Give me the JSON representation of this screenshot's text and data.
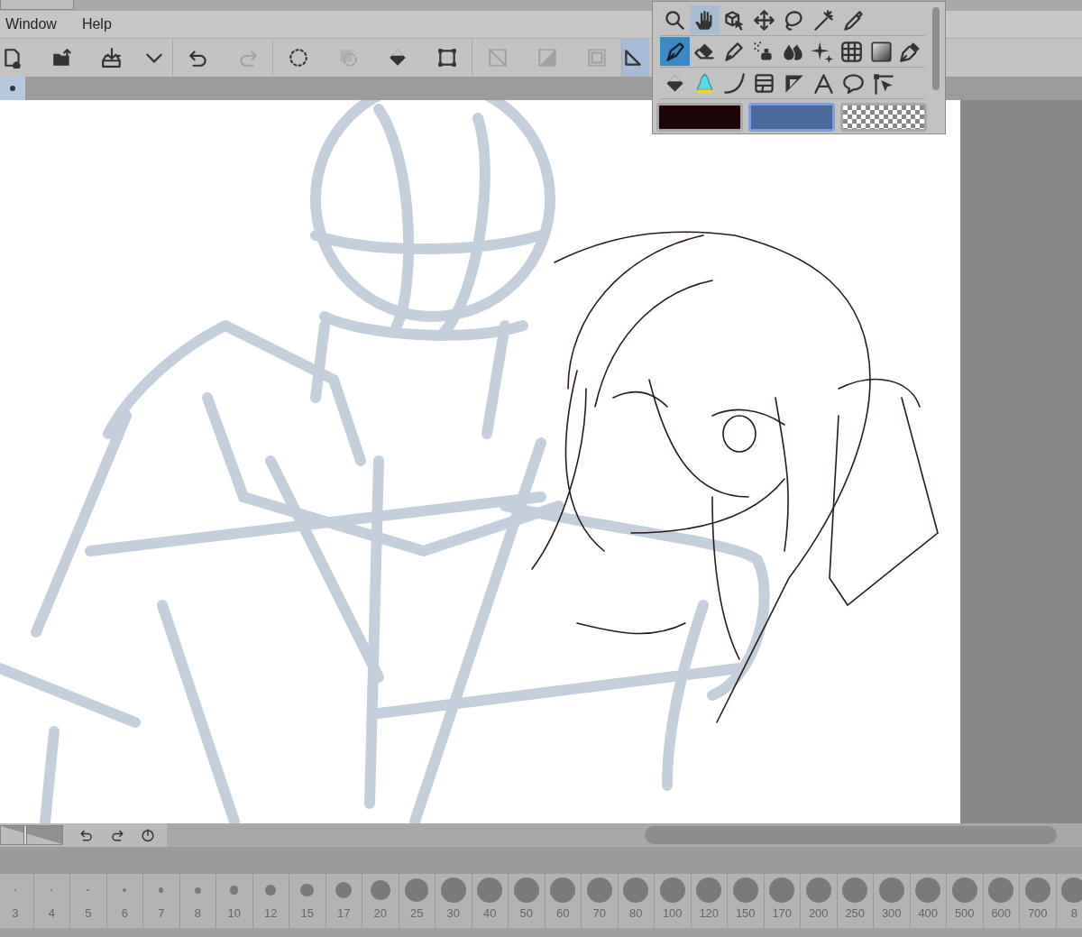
{
  "menu": [
    "Window",
    "Help"
  ],
  "toolbar": [
    {
      "kind": "new",
      "disabled": false,
      "selected": false
    },
    {
      "kind": "open",
      "disabled": false,
      "selected": false
    },
    {
      "kind": "export",
      "disabled": false,
      "selected": false
    },
    {
      "kind": "caret",
      "disabled": false,
      "selected": false
    },
    {
      "kind": "undo",
      "disabled": false,
      "selected": false
    },
    {
      "kind": "redo",
      "disabled": true,
      "selected": false
    },
    {
      "kind": "clear-selection",
      "disabled": false,
      "selected": false
    },
    {
      "kind": "invert-selection",
      "disabled": true,
      "selected": false
    },
    {
      "kind": "fill",
      "disabled": false,
      "selected": false
    },
    {
      "kind": "transform",
      "disabled": false,
      "selected": false
    },
    {
      "kind": "clip",
      "disabled": true,
      "selected": false
    },
    {
      "kind": "half",
      "disabled": true,
      "selected": false
    },
    {
      "kind": "frame",
      "disabled": true,
      "selected": false
    },
    {
      "kind": "ruler",
      "disabled": false,
      "selected": true
    }
  ],
  "tabs": [
    {
      "selected": true
    }
  ],
  "tool_palette": {
    "rows": [
      [
        {
          "kind": "zoom",
          "selected": false
        },
        {
          "kind": "hand",
          "selected": true
        },
        {
          "kind": "object",
          "selected": false
        },
        {
          "kind": "move",
          "selected": false
        },
        {
          "kind": "lasso",
          "selected": false
        },
        {
          "kind": "wand",
          "selected": false
        },
        {
          "kind": "eyedropper",
          "selected": false
        }
      ],
      [
        {
          "kind": "pen",
          "selected": true
        },
        {
          "kind": "eraser",
          "selected": false
        },
        {
          "kind": "pencil",
          "selected": false
        },
        {
          "kind": "airbrush",
          "selected": false
        },
        {
          "kind": "blend",
          "selected": false
        },
        {
          "kind": "sparkle",
          "selected": false
        },
        {
          "kind": "grid",
          "selected": false
        },
        {
          "kind": "gradient",
          "selected": false
        },
        {
          "kind": "nib",
          "selected": false
        }
      ],
      [
        {
          "kind": "fill",
          "selected": false
        },
        {
          "kind": "mascot",
          "selected": false
        },
        {
          "kind": "curve",
          "selected": false
        },
        {
          "kind": "panel",
          "selected": false
        },
        {
          "kind": "triangle",
          "selected": false
        },
        {
          "kind": "text",
          "selected": false
        },
        {
          "kind": "balloon",
          "selected": false
        },
        {
          "kind": "correct",
          "selected": false
        }
      ]
    ],
    "colors": [
      {
        "kind": "solid",
        "color": "#1e0508",
        "selected": false
      },
      {
        "kind": "solid",
        "color": "#4a6a9a",
        "selected": true
      },
      {
        "kind": "transparent",
        "selected": false
      }
    ]
  },
  "canvas_controls": {
    "zoom_slider": {
      "level": 0.35
    }
  },
  "brush_sizes": [
    "3",
    "4",
    "5",
    "6",
    "7",
    "8",
    "10",
    "12",
    "15",
    "17",
    "20",
    "25",
    "30",
    "40",
    "50",
    "60",
    "70",
    "80",
    "100",
    "120",
    "150",
    "170",
    "200",
    "250",
    "300",
    "400",
    "500",
    "600",
    "700",
    "8"
  ]
}
